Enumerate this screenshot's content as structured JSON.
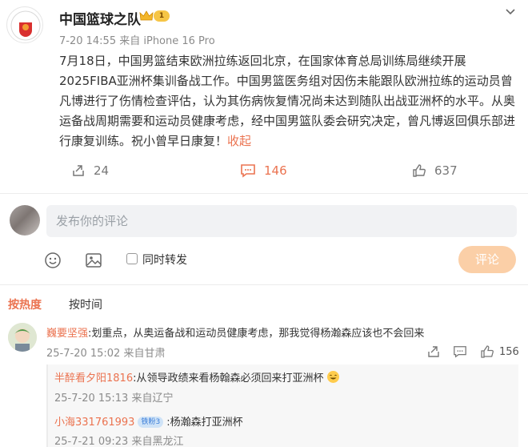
{
  "post": {
    "username": "中国篮球之队",
    "vip_level": "1",
    "meta": "7-20 14:55  来自 iPhone 16 Pro",
    "avatar_text": "TEAM CHINA",
    "content": "7月18日，中国男篮结束欧洲拉练返回北京，在国家体育总局训练局继续开展2025FIBA亚洲杯集训备战工作。中国男篮医务组对因伤未能跟队欧洲拉练的运动员曾凡博进行了伤情检查评估，认为其伤病恢复情况尚未达到随队出战亚洲杯的水平。从奥运备战周期需要和运动员健康考虑，经中国男篮队委会研究决定，曾凡博返回俱乐部进行康复训练。祝小曾早日康复！",
    "collapse_label": "收起",
    "actions": {
      "repost_count": "24",
      "comment_count": "146",
      "like_count": "637"
    }
  },
  "composer": {
    "placeholder": "发布你的评论",
    "repost_label": "同时转发",
    "submit_label": "评论"
  },
  "sort": {
    "hot_label": "按热度",
    "time_label": "按时间"
  },
  "comments": [
    {
      "user": "巍要坚强",
      "text": ":划重点，从奥运备战和运动员健康考虑，那我觉得杨瀚森应该也不会回来",
      "meta": "25-7-20 15:02  来自甘肃",
      "like_count": "156",
      "replies": [
        {
          "user": "半醉看夕阳1816",
          "text": ":从领导政绩来看杨翰森必须回来打亚洲杯",
          "meta": "25-7-20 15:13  来自辽宁"
        },
        {
          "user": "小海331761993",
          "badge": "铁粉3",
          "text": ":杨瀚森打亚洲杯",
          "meta": "25-7-21 09:23  来自黑龙江"
        }
      ]
    }
  ],
  "colors": {
    "accent": "#eb7350",
    "verified": "#1d9bf0",
    "submit_disabled": "#fbcfa7"
  },
  "icons": [
    "crown-icon",
    "verified-badge-icon",
    "chevron-down-icon",
    "repost-icon",
    "comment-icon",
    "like-icon",
    "emoji-icon",
    "image-icon",
    "laughing-emoji-icon"
  ]
}
